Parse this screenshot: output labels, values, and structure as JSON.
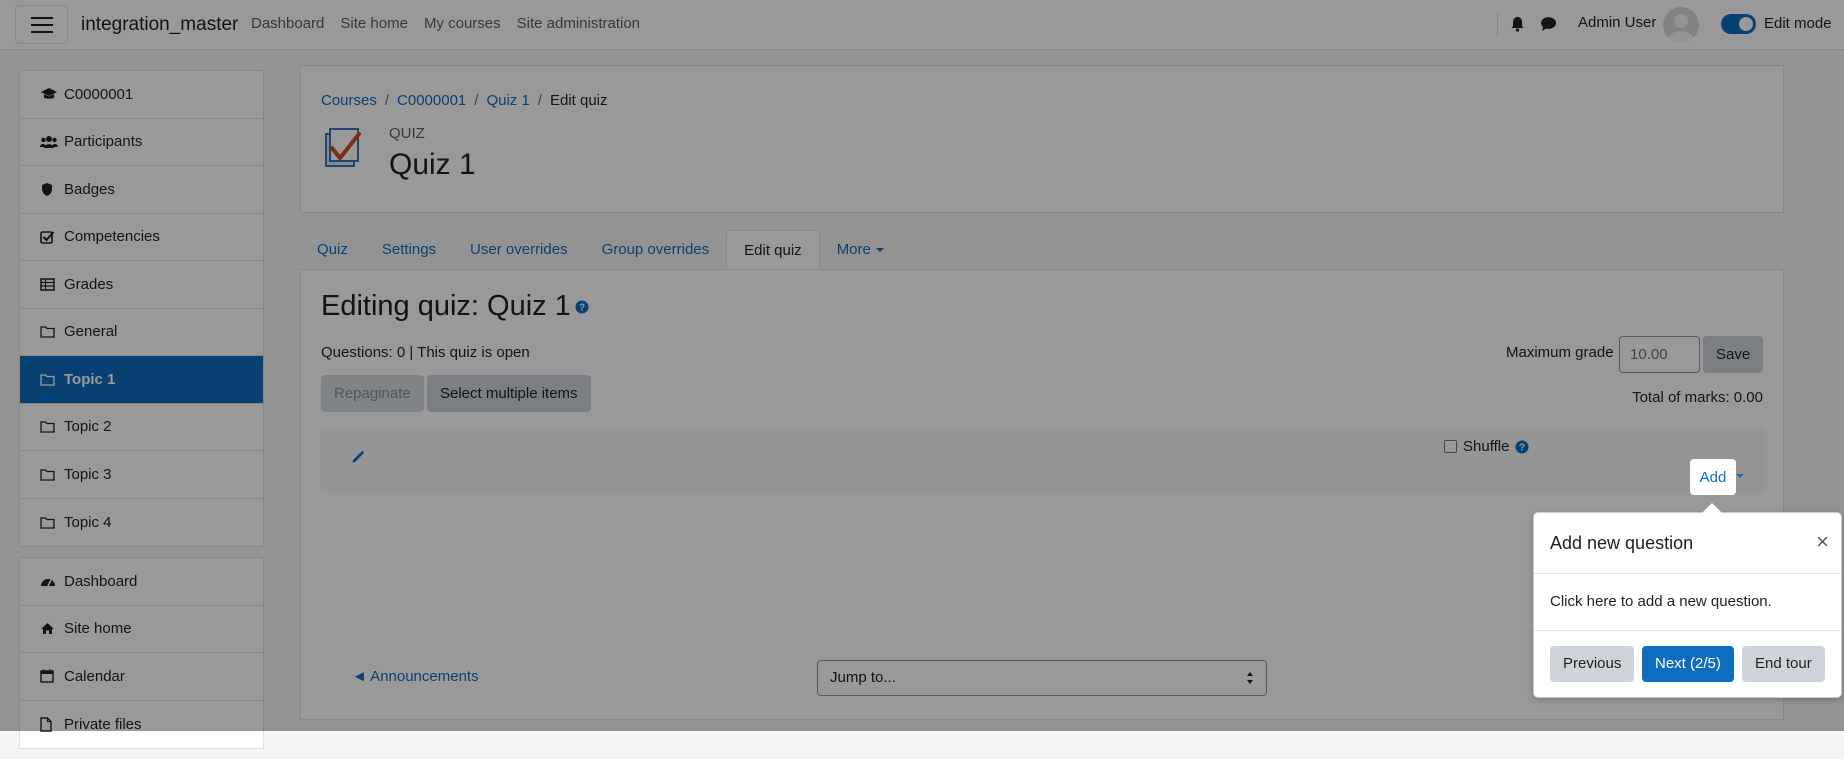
{
  "navbar": {
    "site_name": "integration_master",
    "links": [
      "Dashboard",
      "Site home",
      "My courses",
      "Site administration"
    ],
    "user_name": "Admin User",
    "edit_mode_label": "Edit mode"
  },
  "sidebar": {
    "course_items": [
      {
        "label": "C0000001",
        "icon": "graduation-cap-icon"
      },
      {
        "label": "Participants",
        "icon": "users-icon"
      },
      {
        "label": "Badges",
        "icon": "shield-icon"
      },
      {
        "label": "Competencies",
        "icon": "checkbox-icon"
      },
      {
        "label": "Grades",
        "icon": "table-icon"
      },
      {
        "label": "General",
        "icon": "folder-icon"
      },
      {
        "label": "Topic 1",
        "icon": "folder-icon"
      },
      {
        "label": "Topic 2",
        "icon": "folder-icon"
      },
      {
        "label": "Topic 3",
        "icon": "folder-icon"
      },
      {
        "label": "Topic 4",
        "icon": "folder-icon"
      }
    ],
    "site_items": [
      {
        "label": "Dashboard",
        "icon": "dashboard-icon"
      },
      {
        "label": "Site home",
        "icon": "home-icon"
      },
      {
        "label": "Calendar",
        "icon": "calendar-icon"
      },
      {
        "label": "Private files",
        "icon": "file-icon"
      }
    ],
    "active_item": "Topic 1"
  },
  "header": {
    "breadcrumb": [
      "Courses",
      "C0000001",
      "Quiz 1",
      "Edit quiz"
    ],
    "activity_type": "QUIZ",
    "title": "Quiz 1"
  },
  "tabs": [
    "Quiz",
    "Settings",
    "User overrides",
    "Group overrides",
    "Edit quiz",
    "More"
  ],
  "active_tab": "Edit quiz",
  "editor": {
    "title": "Editing quiz: Quiz 1",
    "status": "Questions: 0 | This quiz is open",
    "repaginate_label": "Repaginate",
    "select_multiple_label": "Select multiple items",
    "max_grade_label": "Maximum grade",
    "max_grade_value": "10.00",
    "save_label": "Save",
    "total_marks": "Total of marks: 0.00",
    "shuffle_label": "Shuffle",
    "add_label": "Add"
  },
  "footer_nav": {
    "prev_link": "◄ Announcements",
    "jump_placeholder": "Jump to..."
  },
  "tour": {
    "title": "Add new question",
    "body": "Click here to add a new question.",
    "previous_label": "Previous",
    "next_label": "Next (2/5)",
    "end_label": "End tour"
  },
  "colors": {
    "primary": "#0f6cbf",
    "secondary": "#ced4da"
  }
}
